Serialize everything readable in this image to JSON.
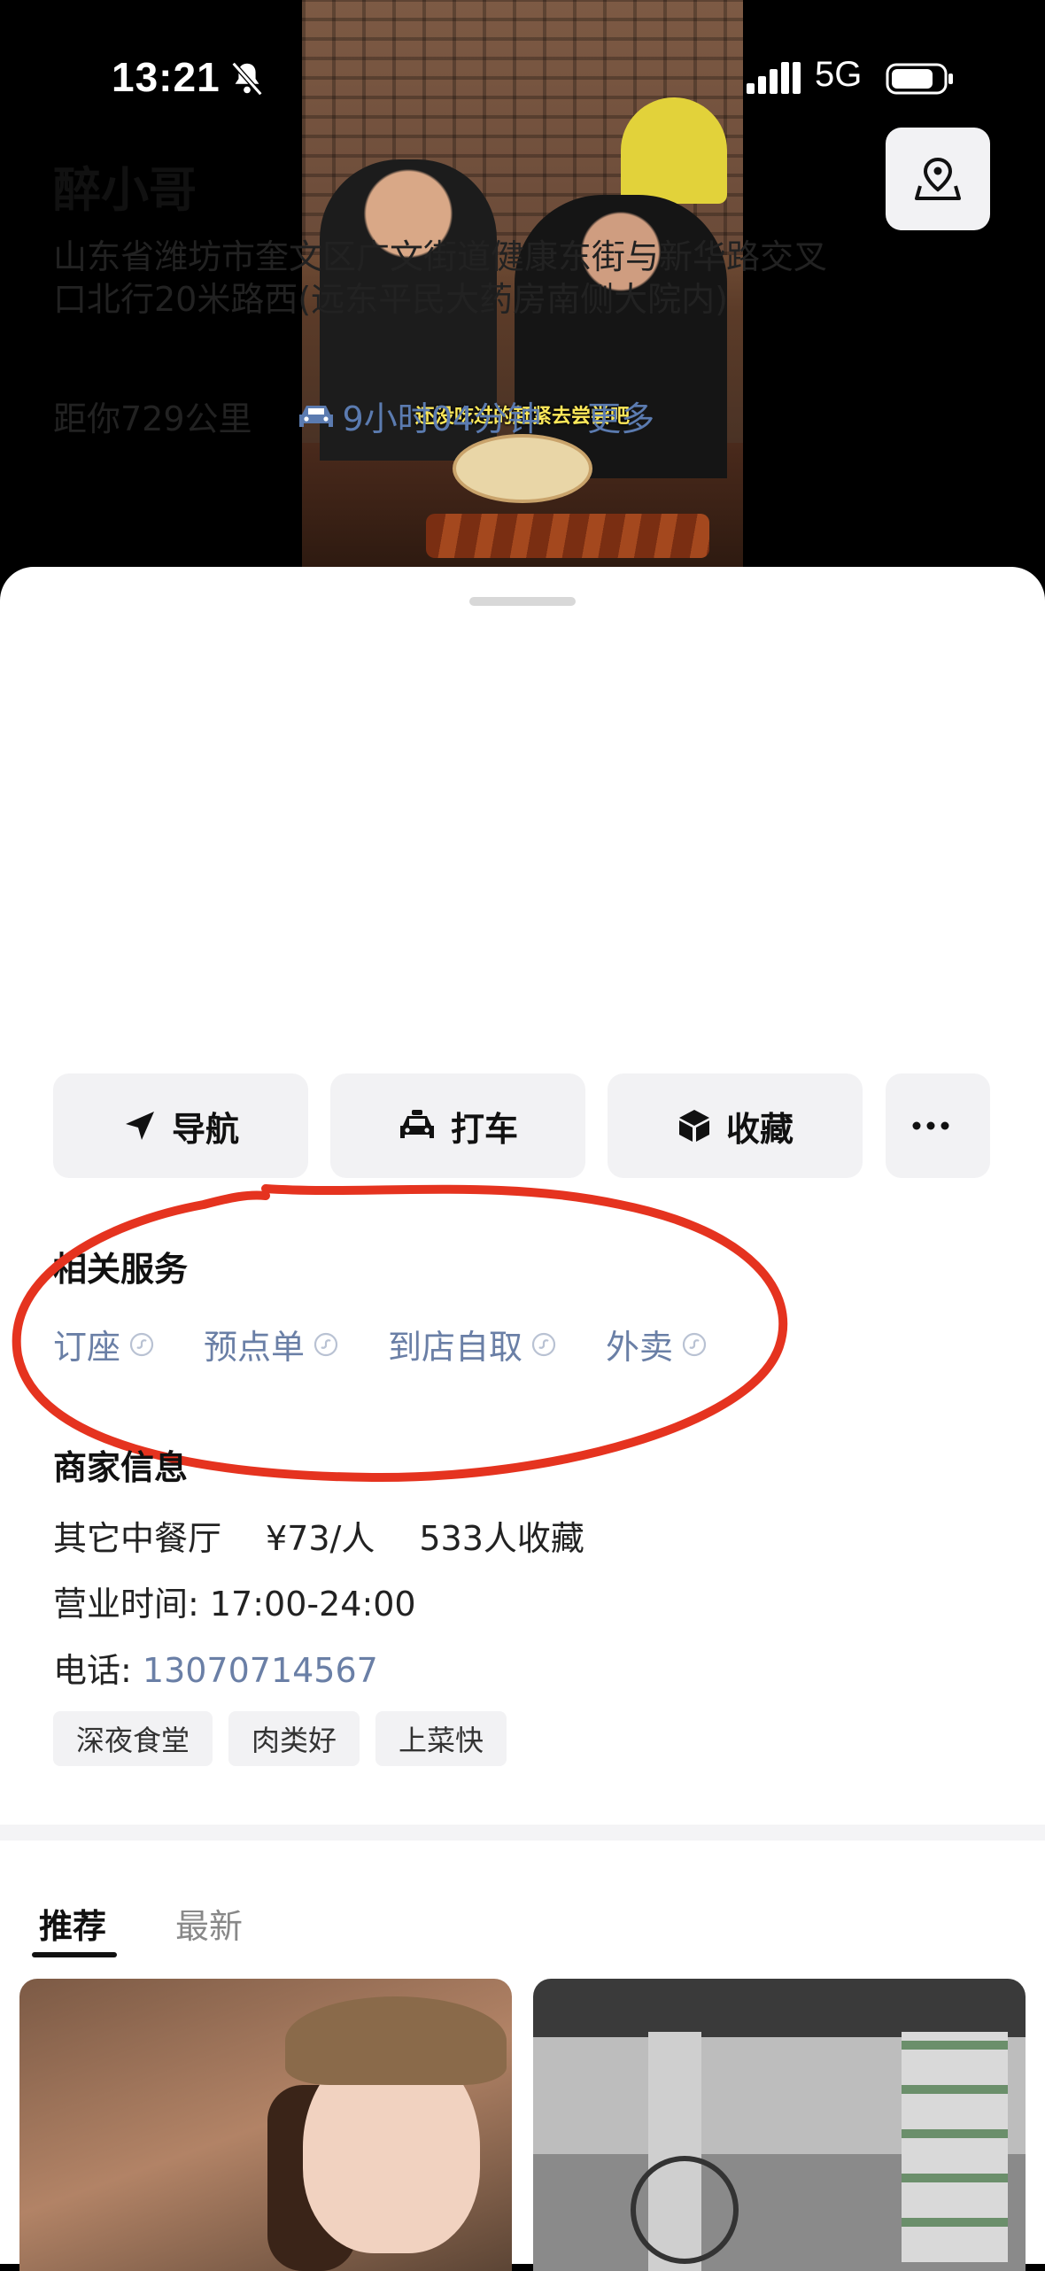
{
  "status_bar": {
    "time": "13:21",
    "network": "5G"
  },
  "video": {
    "subtitle": "还没吃过的赶紧去尝尝吧"
  },
  "place": {
    "name": "醉小哥",
    "address": "山东省潍坊市奎文区广文街道健康东街与新华路交叉口北行20米路西(远东平民大药房南侧大院内)",
    "distance": "距你729公里",
    "drive_time": "9小时04分钟",
    "more": "更多"
  },
  "actions": {
    "navigate": "导航",
    "taxi": "打车",
    "favorite": "收藏"
  },
  "services": {
    "title": "相关服务",
    "items": [
      "订座",
      "预点单",
      "到店自取",
      "外卖"
    ]
  },
  "merchant": {
    "title": "商家信息",
    "category": "其它中餐厅",
    "price": "¥73/人",
    "favorites": "533人收藏",
    "hours": "营业时间: 17:00-24:00",
    "phone_label": "电话: ",
    "phone_number": "13070714567",
    "tags": [
      "深夜食堂",
      "肉类好",
      "上菜快"
    ]
  },
  "tabs": {
    "recommend": "推荐",
    "latest": "最新"
  },
  "colors": {
    "link": "#5b7bb0",
    "annotation": "#e5331f"
  }
}
